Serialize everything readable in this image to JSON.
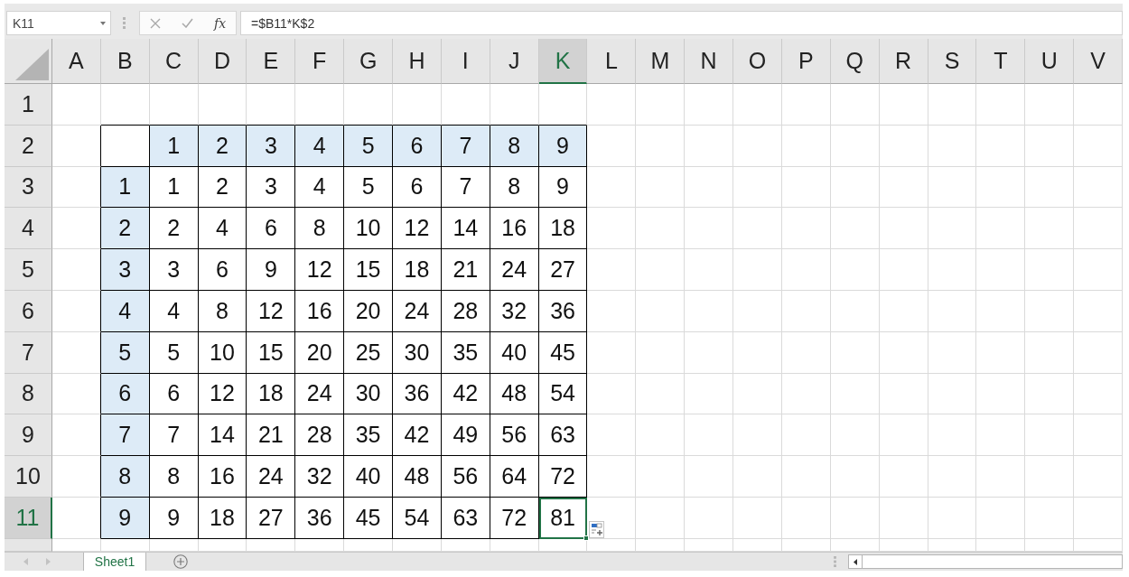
{
  "name_box": {
    "value": "K11"
  },
  "formula_bar": {
    "function_label": "fx",
    "formula": "=$B11*K$2"
  },
  "columns": [
    {
      "label": "A",
      "selected": false
    },
    {
      "label": "B",
      "selected": false
    },
    {
      "label": "C",
      "selected": false
    },
    {
      "label": "D",
      "selected": false
    },
    {
      "label": "E",
      "selected": false
    },
    {
      "label": "F",
      "selected": false
    },
    {
      "label": "G",
      "selected": false
    },
    {
      "label": "H",
      "selected": false
    },
    {
      "label": "I",
      "selected": false
    },
    {
      "label": "J",
      "selected": false
    },
    {
      "label": "K",
      "selected": true
    },
    {
      "label": "L",
      "selected": false
    },
    {
      "label": "M",
      "selected": false
    },
    {
      "label": "N",
      "selected": false
    },
    {
      "label": "O",
      "selected": false
    },
    {
      "label": "P",
      "selected": false
    },
    {
      "label": "Q",
      "selected": false
    },
    {
      "label": "R",
      "selected": false
    },
    {
      "label": "S",
      "selected": false
    },
    {
      "label": "T",
      "selected": false
    },
    {
      "label": "U",
      "selected": false
    },
    {
      "label": "V",
      "selected": false
    }
  ],
  "rows": [
    {
      "label": "1",
      "selected": false
    },
    {
      "label": "2",
      "selected": false
    },
    {
      "label": "3",
      "selected": false
    },
    {
      "label": "4",
      "selected": false
    },
    {
      "label": "5",
      "selected": false
    },
    {
      "label": "6",
      "selected": false
    },
    {
      "label": "7",
      "selected": false
    },
    {
      "label": "8",
      "selected": false
    },
    {
      "label": "9",
      "selected": false
    },
    {
      "label": "10",
      "selected": false
    },
    {
      "label": "11",
      "selected": true
    }
  ],
  "table": {
    "column_labels": [
      "1",
      "2",
      "3",
      "4",
      "5",
      "6",
      "7",
      "8",
      "9"
    ],
    "rows": [
      {
        "label": "1",
        "cells": [
          {
            "value": "1",
            "selected": false
          },
          {
            "value": "2",
            "selected": false
          },
          {
            "value": "3",
            "selected": false
          },
          {
            "value": "4",
            "selected": false
          },
          {
            "value": "5",
            "selected": false
          },
          {
            "value": "6",
            "selected": false
          },
          {
            "value": "7",
            "selected": false
          },
          {
            "value": "8",
            "selected": false
          },
          {
            "value": "9",
            "selected": false
          }
        ]
      },
      {
        "label": "2",
        "cells": [
          {
            "value": "2",
            "selected": false
          },
          {
            "value": "4",
            "selected": false
          },
          {
            "value": "6",
            "selected": false
          },
          {
            "value": "8",
            "selected": false
          },
          {
            "value": "10",
            "selected": false
          },
          {
            "value": "12",
            "selected": false
          },
          {
            "value": "14",
            "selected": false
          },
          {
            "value": "16",
            "selected": false
          },
          {
            "value": "18",
            "selected": false
          }
        ]
      },
      {
        "label": "3",
        "cells": [
          {
            "value": "3",
            "selected": false
          },
          {
            "value": "6",
            "selected": false
          },
          {
            "value": "9",
            "selected": false
          },
          {
            "value": "12",
            "selected": false
          },
          {
            "value": "15",
            "selected": false
          },
          {
            "value": "18",
            "selected": false
          },
          {
            "value": "21",
            "selected": false
          },
          {
            "value": "24",
            "selected": false
          },
          {
            "value": "27",
            "selected": false
          }
        ]
      },
      {
        "label": "4",
        "cells": [
          {
            "value": "4",
            "selected": false
          },
          {
            "value": "8",
            "selected": false
          },
          {
            "value": "12",
            "selected": false
          },
          {
            "value": "16",
            "selected": false
          },
          {
            "value": "20",
            "selected": false
          },
          {
            "value": "24",
            "selected": false
          },
          {
            "value": "28",
            "selected": false
          },
          {
            "value": "32",
            "selected": false
          },
          {
            "value": "36",
            "selected": false
          }
        ]
      },
      {
        "label": "5",
        "cells": [
          {
            "value": "5",
            "selected": false
          },
          {
            "value": "10",
            "selected": false
          },
          {
            "value": "15",
            "selected": false
          },
          {
            "value": "20",
            "selected": false
          },
          {
            "value": "25",
            "selected": false
          },
          {
            "value": "30",
            "selected": false
          },
          {
            "value": "35",
            "selected": false
          },
          {
            "value": "40",
            "selected": false
          },
          {
            "value": "45",
            "selected": false
          }
        ]
      },
      {
        "label": "6",
        "cells": [
          {
            "value": "6",
            "selected": false
          },
          {
            "value": "12",
            "selected": false
          },
          {
            "value": "18",
            "selected": false
          },
          {
            "value": "24",
            "selected": false
          },
          {
            "value": "30",
            "selected": false
          },
          {
            "value": "36",
            "selected": false
          },
          {
            "value": "42",
            "selected": false
          },
          {
            "value": "48",
            "selected": false
          },
          {
            "value": "54",
            "selected": false
          }
        ]
      },
      {
        "label": "7",
        "cells": [
          {
            "value": "7",
            "selected": false
          },
          {
            "value": "14",
            "selected": false
          },
          {
            "value": "21",
            "selected": false
          },
          {
            "value": "28",
            "selected": false
          },
          {
            "value": "35",
            "selected": false
          },
          {
            "value": "42",
            "selected": false
          },
          {
            "value": "49",
            "selected": false
          },
          {
            "value": "56",
            "selected": false
          },
          {
            "value": "63",
            "selected": false
          }
        ]
      },
      {
        "label": "8",
        "cells": [
          {
            "value": "8",
            "selected": false
          },
          {
            "value": "16",
            "selected": false
          },
          {
            "value": "24",
            "selected": false
          },
          {
            "value": "32",
            "selected": false
          },
          {
            "value": "40",
            "selected": false
          },
          {
            "value": "48",
            "selected": false
          },
          {
            "value": "56",
            "selected": false
          },
          {
            "value": "64",
            "selected": false
          },
          {
            "value": "72",
            "selected": false
          }
        ]
      },
      {
        "label": "9",
        "cells": [
          {
            "value": "9",
            "selected": false
          },
          {
            "value": "18",
            "selected": false
          },
          {
            "value": "27",
            "selected": false
          },
          {
            "value": "36",
            "selected": false
          },
          {
            "value": "45",
            "selected": false
          },
          {
            "value": "54",
            "selected": false
          },
          {
            "value": "63",
            "selected": false
          },
          {
            "value": "72",
            "selected": false
          },
          {
            "value": "81",
            "selected": true
          }
        ]
      }
    ]
  },
  "sheet_tabs": [
    {
      "label": "Sheet1",
      "selected": true
    }
  ]
}
